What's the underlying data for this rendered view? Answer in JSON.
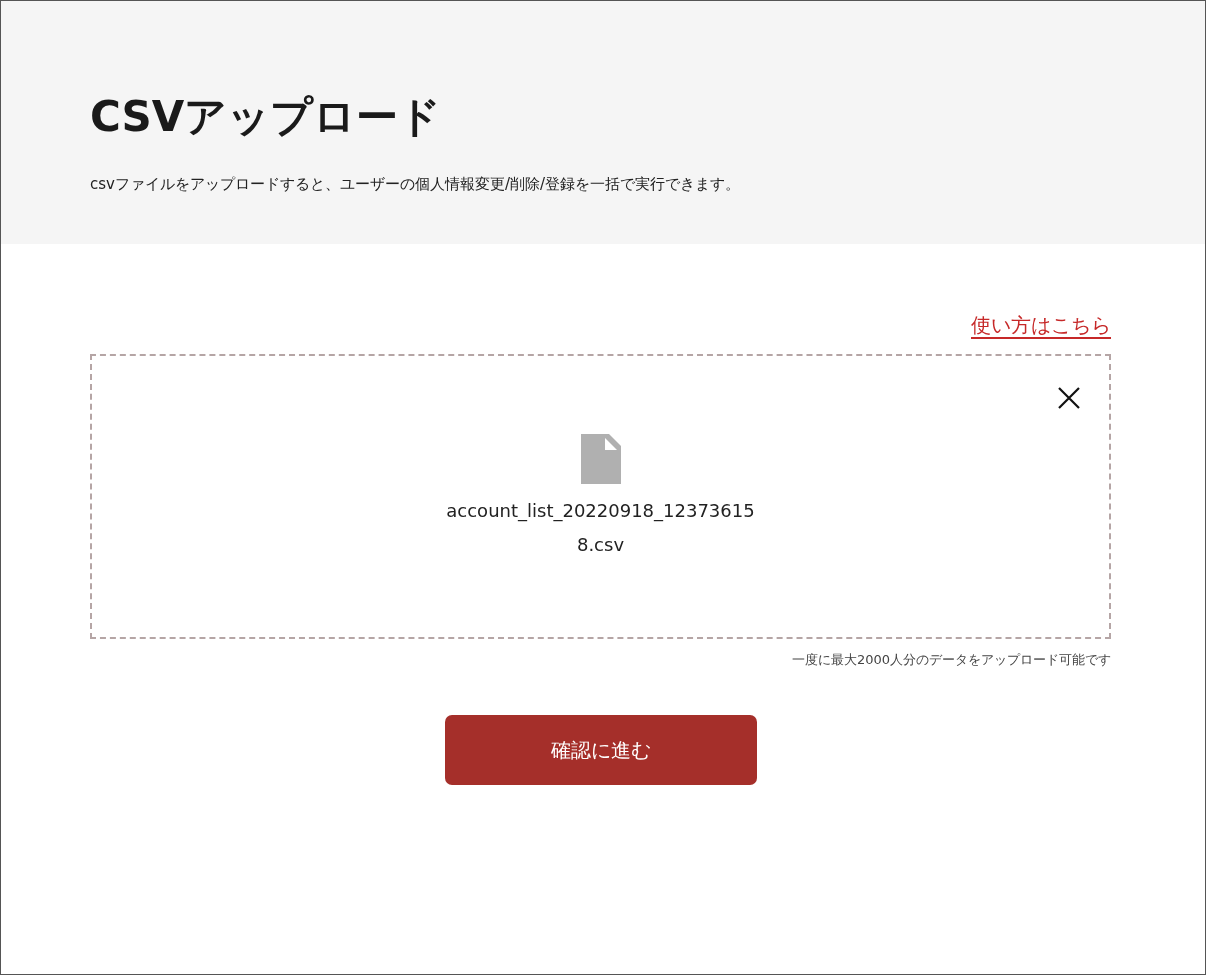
{
  "header": {
    "title": "CSVアップロード",
    "description": "csvファイルをアップロードすると、ユーザーの個人情報変更/削除/登録を一括で実行できます。"
  },
  "help_link": "使い方はこちら",
  "dropzone": {
    "file_name_lines": [
      "account_list_20220918_12373615",
      "8.csv"
    ]
  },
  "note": "一度に最大2000人分のデータをアップロード可能です",
  "submit_button": "確認に進む"
}
